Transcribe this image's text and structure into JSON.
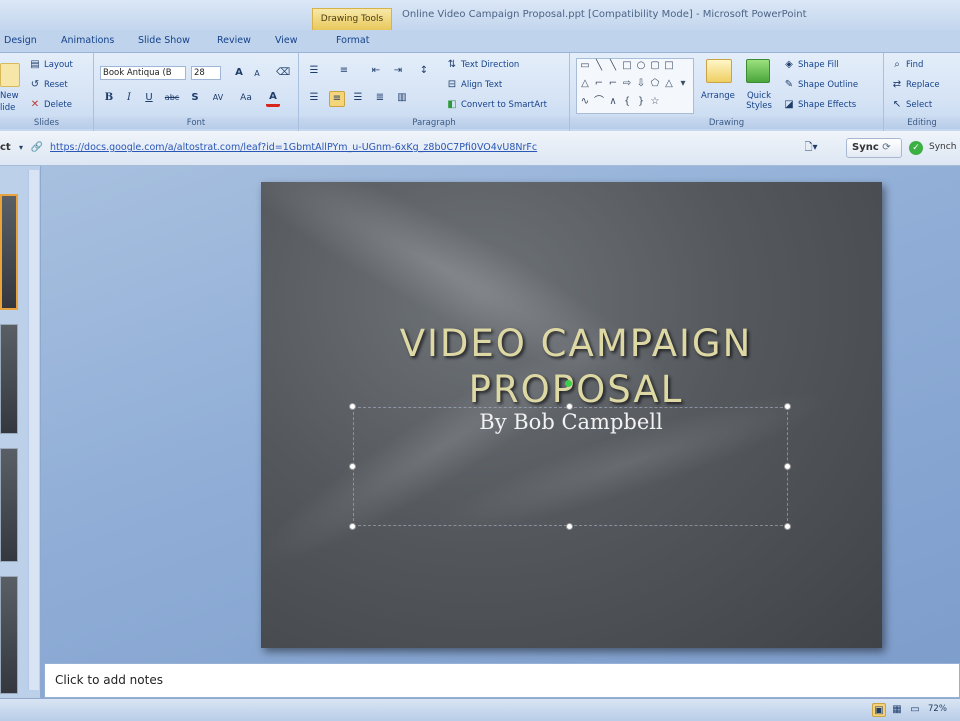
{
  "window": {
    "contextual_tab_group": "Drawing Tools",
    "title": "Online Video Campaign Proposal.ppt [Compatibility Mode] - Microsoft PowerPoint"
  },
  "tabs": [
    "Design",
    "Animations",
    "Slide Show",
    "Review",
    "View",
    "Format"
  ],
  "ribbon": {
    "slides": {
      "label": "Slides",
      "layout": "Layout",
      "reset": "Reset",
      "delete": "Delete",
      "new_slide_partial_1": "New",
      "new_slide_partial_2": "lide"
    },
    "font": {
      "label": "Font",
      "font_name": "Book Antiqua (B",
      "font_size": "28",
      "bold": "B",
      "italic": "I",
      "underline": "U",
      "strike": "abc",
      "shadow": "S",
      "spacing": "AV",
      "change_case": "Aa",
      "font_color": "A",
      "grow": "A",
      "shrink": "A"
    },
    "paragraph": {
      "label": "Paragraph",
      "text_direction": "Text Direction",
      "align_text": "Align Text",
      "convert_smartart": "Convert to SmartArt"
    },
    "drawing": {
      "label": "Drawing",
      "arrange": "Arrange",
      "quick_styles": "Quick Styles",
      "shape_fill": "Shape Fill",
      "shape_outline": "Shape Outline",
      "shape_effects": "Shape Effects"
    },
    "editing": {
      "label": "Editing",
      "find": "Find",
      "replace": "Replace",
      "select": "Select"
    }
  },
  "address_bar": {
    "left_stub": "ct",
    "url": "https://docs.google.com/a/altostrat.com/leaf?id=1GbmtAllPYm_u-UGnm-6xKg_z8b0C7Pfi0VO4vU8NrFc",
    "sync_label": "Sync",
    "sync_status": "Synch"
  },
  "slide": {
    "title_line1": "VIDEO CAMPAIGN",
    "title_line2": "PROPOSAL",
    "subtitle": "By Bob Campbell"
  },
  "notes": {
    "placeholder": "Click to add notes"
  },
  "status": {
    "zoom": "72%"
  },
  "colors": {
    "accent_orange": "#e8a33d",
    "title_text": "#ded9a4",
    "link": "#2a56b5"
  }
}
